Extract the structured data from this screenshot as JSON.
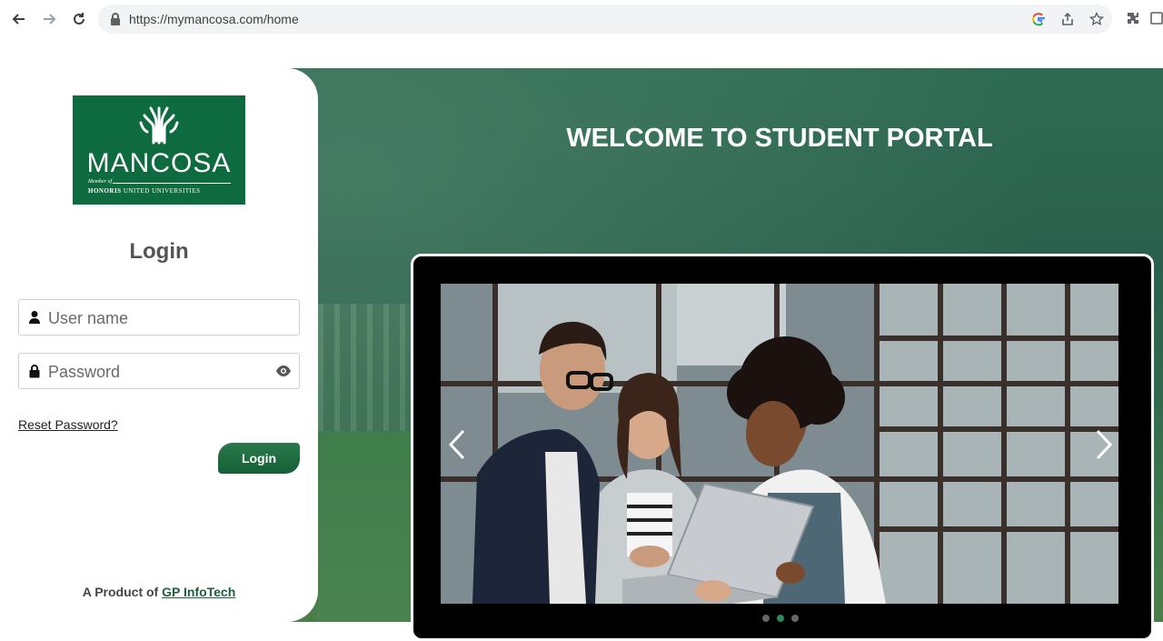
{
  "browser": {
    "url": "https://mymancosa.com/home",
    "icons": [
      "back-icon",
      "forward-icon",
      "reload-icon",
      "lock-icon",
      "google-icon",
      "share-icon",
      "star-icon",
      "extensions-icon",
      "side-panel-icon"
    ]
  },
  "logo": {
    "name": "MANCOSA",
    "member_of": "Member of",
    "affiliation_bold": "HONORIS",
    "affiliation_rest": "UNITED UNIVERSITIES"
  },
  "login": {
    "title": "Login",
    "username_placeholder": "User name",
    "password_placeholder": "Password",
    "reset_link": "Reset Password?",
    "button": "Login"
  },
  "footer": {
    "prefix": "A Product of",
    "link": "GP InfoTech"
  },
  "hero": {
    "title": "WELCOME TO STUDENT PORTAL"
  },
  "carousel": {
    "slide_count": 3,
    "active_slide": 2
  },
  "colors": {
    "brand_green": "#0e6b3f",
    "button_green": "#155f36"
  }
}
